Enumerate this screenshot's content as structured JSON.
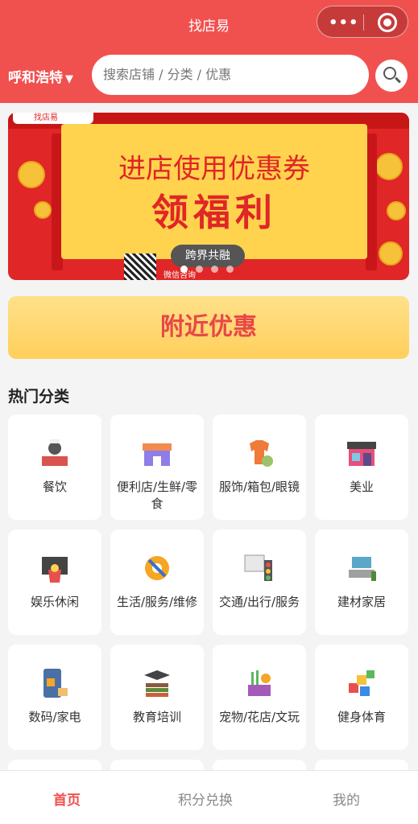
{
  "header": {
    "title": "找店易"
  },
  "search": {
    "city": "呼和浩特",
    "placeholder": "搜索店铺 / 分类 / 优惠"
  },
  "banner": {
    "logo_text": "找店易",
    "headline": "进店使用优惠券",
    "big_text": "领福利",
    "pill_text": "跨界共融",
    "wechat_text": "微信咨询"
  },
  "nearby": {
    "label": "附近优惠"
  },
  "categories_title": "热门分类",
  "categories": [
    {
      "label": "餐饮",
      "icon": "dining-icon"
    },
    {
      "label": "便利店/生鲜/零食",
      "icon": "store-icon"
    },
    {
      "label": "服饰/箱包/眼镜",
      "icon": "clothing-icon"
    },
    {
      "label": "美业",
      "icon": "beauty-shop-icon"
    },
    {
      "label": "娱乐休闲",
      "icon": "entertainment-icon"
    },
    {
      "label": "生活/服务/维修",
      "icon": "repair-icon"
    },
    {
      "label": "交通/出行/服务",
      "icon": "traffic-icon"
    },
    {
      "label": "建材家居",
      "icon": "furniture-icon"
    },
    {
      "label": "数码/家电",
      "icon": "electronics-icon"
    },
    {
      "label": "教育培训",
      "icon": "education-icon"
    },
    {
      "label": "宠物/花店/文玩",
      "icon": "pet-flower-icon"
    },
    {
      "label": "健身体育",
      "icon": "fitness-icon"
    }
  ],
  "tabs": [
    {
      "label": "首页",
      "active": true
    },
    {
      "label": "积分兑换",
      "active": false
    },
    {
      "label": "我的",
      "active": false
    }
  ],
  "colors": {
    "brand": "#f0514f",
    "accent_yellow": "#ffd34e"
  }
}
